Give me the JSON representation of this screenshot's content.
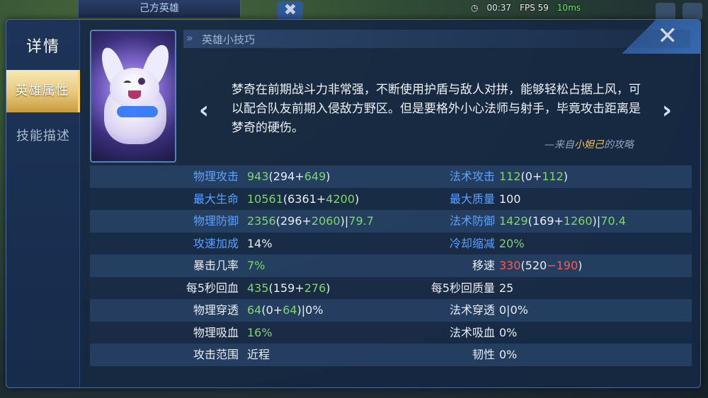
{
  "background": {
    "team_label": "己方英雄",
    "timer": "00:37",
    "fps": "FPS 59",
    "ping": "10ms"
  },
  "sidebar": {
    "title": "详情",
    "tabs": [
      {
        "label": "英雄属性",
        "active": true
      },
      {
        "label": "技能描述",
        "active": false
      }
    ]
  },
  "tips": {
    "header": "英雄小技巧",
    "text": "梦奇在前期战斗力非常强，不断使用护盾与敌人对拼，能够轻松占据上风，可以配合队友前期入侵敌方野区。但是要格外小心法师与射手，毕竟攻击距离是梦奇的硬伤。",
    "source_prefix": "—来自",
    "source_author": "小妲己",
    "source_suffix": "的攻略"
  },
  "stats": [
    {
      "l1": "物理攻击",
      "l1_color": "blue",
      "v1": [
        [
          "943",
          "g"
        ],
        [
          "(294+",
          "w"
        ],
        [
          "649",
          "g"
        ],
        [
          ")",
          "w"
        ]
      ],
      "l2": "法术攻击",
      "l2_color": "blue",
      "v2": [
        [
          "112",
          "g"
        ],
        [
          "(0+",
          "w"
        ],
        [
          "112",
          "g"
        ],
        [
          ")",
          "w"
        ]
      ]
    },
    {
      "l1": "最大生命",
      "l1_color": "blue",
      "v1": [
        [
          "10561",
          "g"
        ],
        [
          "(6361+",
          "w"
        ],
        [
          "4200",
          "g"
        ],
        [
          ")",
          "w"
        ]
      ],
      "l2": "最大质量",
      "l2_color": "blue",
      "v2": [
        [
          "100",
          "w"
        ]
      ]
    },
    {
      "l1": "物理防御",
      "l1_color": "blue",
      "v1": [
        [
          "2356",
          "g"
        ],
        [
          "(296+",
          "w"
        ],
        [
          "2060",
          "g"
        ],
        [
          ")|",
          "w"
        ],
        [
          "79.7",
          "g"
        ]
      ],
      "l2": "法术防御",
      "l2_color": "blue",
      "v2": [
        [
          "1429",
          "g"
        ],
        [
          "(169+",
          "w"
        ],
        [
          "1260",
          "g"
        ],
        [
          ")|",
          "w"
        ],
        [
          "70.4",
          "g"
        ]
      ]
    },
    {
      "l1": "攻速加成",
      "l1_color": "blue",
      "v1": [
        [
          "14%",
          "w"
        ]
      ],
      "l2": "冷却缩减",
      "l2_color": "blue",
      "v2": [
        [
          "20%",
          "g"
        ]
      ]
    },
    {
      "l1": "暴击几率",
      "l1_color": "white",
      "v1": [
        [
          "7%",
          "g"
        ]
      ],
      "l2": "移速",
      "l2_color": "white",
      "v2": [
        [
          "330",
          "r"
        ],
        [
          "(520",
          "w"
        ],
        [
          "−190",
          "r"
        ],
        [
          ")",
          "w"
        ]
      ]
    },
    {
      "l1": "每5秒回血",
      "l1_color": "white",
      "v1": [
        [
          "435",
          "g"
        ],
        [
          "(159+",
          "w"
        ],
        [
          "276",
          "g"
        ],
        [
          ")",
          "w"
        ]
      ],
      "l2": "每5秒回质量",
      "l2_color": "white",
      "v2": [
        [
          "25",
          "w"
        ]
      ]
    },
    {
      "l1": "物理穿透",
      "l1_color": "white",
      "v1": [
        [
          "64",
          "g"
        ],
        [
          "(0+",
          "w"
        ],
        [
          "64",
          "g"
        ],
        [
          ")|0%",
          "w"
        ]
      ],
      "l2": "法术穿透",
      "l2_color": "white",
      "v2": [
        [
          "0|0%",
          "w"
        ]
      ]
    },
    {
      "l1": "物理吸血",
      "l1_color": "white",
      "v1": [
        [
          "16%",
          "g"
        ]
      ],
      "l2": "法术吸血",
      "l2_color": "white",
      "v2": [
        [
          "0%",
          "w"
        ]
      ]
    },
    {
      "l1": "攻击范围",
      "l1_color": "white",
      "v1": [
        [
          "近程",
          "w"
        ]
      ],
      "l2": "韧性",
      "l2_color": "white",
      "v2": [
        [
          "0%",
          "w"
        ]
      ]
    }
  ]
}
